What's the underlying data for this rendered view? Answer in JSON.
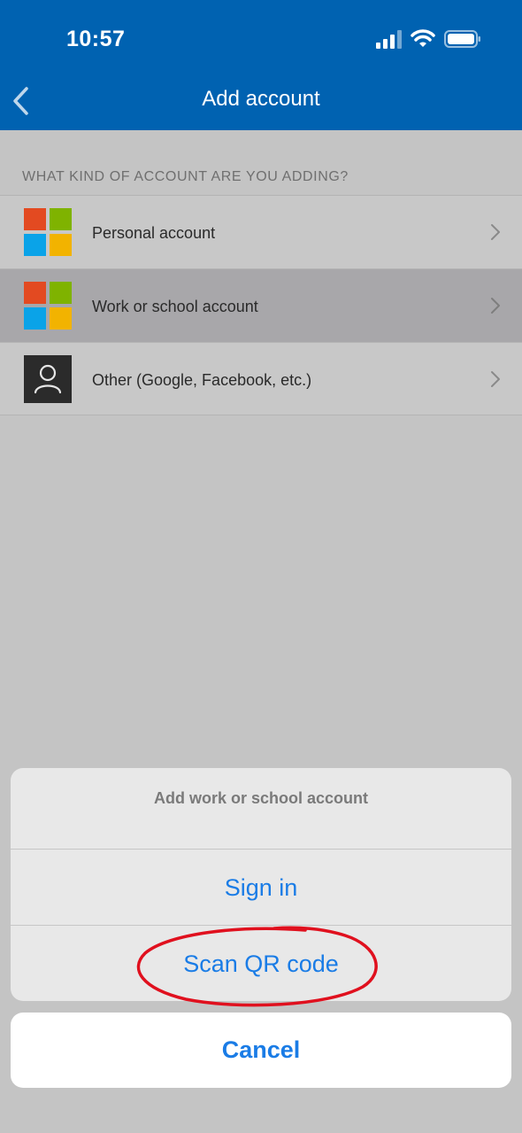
{
  "status_bar": {
    "time": "10:57",
    "icons": [
      "cellular-signal-icon",
      "wifi-icon",
      "battery-icon"
    ]
  },
  "nav": {
    "title": "Add account",
    "back_icon": "chevron-left-icon"
  },
  "section_header": "WHAT KIND OF ACCOUNT ARE YOU ADDING?",
  "account_types": [
    {
      "label": "Personal account",
      "icon": "microsoft-logo-icon",
      "selected": false
    },
    {
      "label": "Work or school account",
      "icon": "microsoft-logo-icon",
      "selected": true
    },
    {
      "label": "Other (Google, Facebook, etc.)",
      "icon": "person-icon",
      "selected": false
    }
  ],
  "action_sheet": {
    "title": "Add work or school account",
    "actions": [
      "Sign in",
      "Scan QR code"
    ],
    "cancel": "Cancel"
  },
  "colors": {
    "header_bg": "#0062b1",
    "action_blue": "#1a7ce6",
    "annotation_red": "#e0101e",
    "ms_red": "#e34a21",
    "ms_green": "#7fb300",
    "ms_blue": "#0aa3e8",
    "ms_yellow": "#f2b300"
  }
}
